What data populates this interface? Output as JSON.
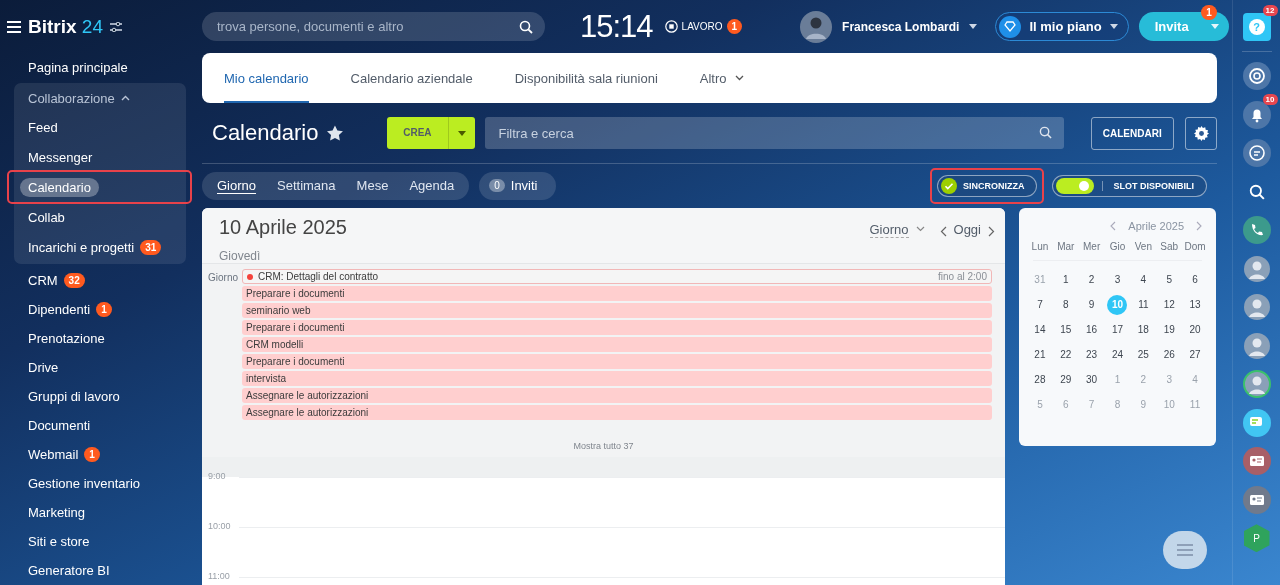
{
  "header": {
    "logo": {
      "name": "Bitrix",
      "number": "24"
    },
    "search": {
      "placeholder": "trova persone, documenti e altro"
    },
    "clock": "15:14",
    "work_status": {
      "label": "LAVORO",
      "badge": "1"
    },
    "user": {
      "name": "Francesca Lombardi"
    },
    "plan": {
      "label": "Il mio piano"
    },
    "invite": {
      "label": "Invita",
      "badge": "1"
    }
  },
  "sidebar": {
    "items": [
      {
        "label": "Pagina principale",
        "kind": "item",
        "selected": false
      },
      {
        "label": "Collaborazione",
        "kind": "group",
        "expanded": true,
        "children": [
          {
            "label": "Feed",
            "selected": false,
            "highlighted": false
          },
          {
            "label": "Messenger",
            "selected": false,
            "highlighted": false
          },
          {
            "label": "Calendario",
            "selected": true,
            "highlighted": true
          },
          {
            "label": "Collab",
            "selected": false,
            "highlighted": false
          },
          {
            "label": "Incarichi e progetti",
            "badge": "31",
            "selected": false,
            "highlighted": false
          }
        ]
      },
      {
        "label": "CRM",
        "badge": "32",
        "kind": "item",
        "selected": false
      },
      {
        "label": "Dipendenti",
        "badge": "1",
        "kind": "item",
        "selected": false
      },
      {
        "label": "Prenotazione",
        "kind": "item",
        "selected": false
      },
      {
        "label": "Drive",
        "kind": "item",
        "selected": false
      },
      {
        "label": "Gruppi di lavoro",
        "kind": "item",
        "selected": false
      },
      {
        "label": "Documenti",
        "kind": "item",
        "selected": false
      },
      {
        "label": "Webmail",
        "badge": "1",
        "kind": "item",
        "selected": false
      },
      {
        "label": "Gestione inventario",
        "kind": "item",
        "selected": false
      },
      {
        "label": "Marketing",
        "kind": "item",
        "selected": false
      },
      {
        "label": "Siti e store",
        "kind": "item",
        "selected": false
      },
      {
        "label": "Generatore BI",
        "kind": "item",
        "selected": false
      }
    ]
  },
  "tabs": [
    {
      "label": "Mio calendario",
      "selected": true,
      "kind": "tab"
    },
    {
      "label": "Calendario aziendale",
      "selected": false,
      "kind": "tab"
    },
    {
      "label": "Disponibilità sala riunioni",
      "selected": false,
      "kind": "tab"
    },
    {
      "label": "Altro",
      "selected": false,
      "kind": "more"
    }
  ],
  "toolbar": {
    "title": "Calendario",
    "create": "CREA",
    "filter": {
      "placeholder": "Filtra e cerca"
    },
    "calendars": "CALENDARI"
  },
  "views": [
    {
      "label": "Giorno",
      "selected": true
    },
    {
      "label": "Settimana",
      "selected": false
    },
    {
      "label": "Mese",
      "selected": false
    },
    {
      "label": "Agenda",
      "selected": false
    }
  ],
  "invites": {
    "count": "0",
    "label": "Inviti"
  },
  "sync": {
    "label": "SINCRONIZZA",
    "checked": true,
    "highlighted": true
  },
  "slots": {
    "label": "SLOT DISPONIBILI",
    "on": true
  },
  "day_view": {
    "date": "10 Aprile 2025",
    "weekday": "Giovedì",
    "view_select": "Giorno",
    "today": "Oggi",
    "allday_label": "Giorno",
    "events": [
      {
        "title": "CRM: Dettagli del contratto",
        "kind": "crm",
        "end": "fino al 2:00"
      },
      {
        "title": "Preparare i documenti",
        "kind": "event"
      },
      {
        "title": "seminario web",
        "kind": "event"
      },
      {
        "title": "Preparare i documenti",
        "kind": "event"
      },
      {
        "title": "CRM modelli",
        "kind": "event"
      },
      {
        "title": "Preparare i documenti",
        "kind": "event"
      },
      {
        "title": "intervista",
        "kind": "event"
      },
      {
        "title": "Assegnare le autorizzazioni",
        "kind": "event"
      },
      {
        "title": "Assegnare le autorizzazioni",
        "kind": "event"
      }
    ],
    "show_all": "Mostra tutto 37",
    "hours": [
      "9:00",
      "10:00",
      "11:00"
    ]
  },
  "mini_calendar": {
    "title": "Aprile 2025",
    "weekdays": [
      "Lun",
      "Mar",
      "Mer",
      "Gio",
      "Ven",
      "Sab",
      "Dom"
    ],
    "weeks": [
      [
        {
          "day": "31",
          "muted": true,
          "selected": false
        },
        {
          "day": "1",
          "muted": false,
          "selected": false
        },
        {
          "day": "2",
          "muted": false,
          "selected": false
        },
        {
          "day": "3",
          "muted": false,
          "selected": false
        },
        {
          "day": "4",
          "muted": false,
          "selected": false
        },
        {
          "day": "5",
          "muted": false,
          "selected": false
        },
        {
          "day": "6",
          "muted": false,
          "selected": false
        }
      ],
      [
        {
          "day": "7",
          "muted": false,
          "selected": false
        },
        {
          "day": "8",
          "muted": false,
          "selected": false
        },
        {
          "day": "9",
          "muted": false,
          "selected": false
        },
        {
          "day": "10",
          "muted": false,
          "selected": true
        },
        {
          "day": "11",
          "muted": false,
          "selected": false
        },
        {
          "day": "12",
          "muted": false,
          "selected": false
        },
        {
          "day": "13",
          "muted": false,
          "selected": false
        }
      ],
      [
        {
          "day": "14",
          "muted": false,
          "selected": false
        },
        {
          "day": "15",
          "muted": false,
          "selected": false
        },
        {
          "day": "16",
          "muted": false,
          "selected": false
        },
        {
          "day": "17",
          "muted": false,
          "selected": false
        },
        {
          "day": "18",
          "muted": false,
          "selected": false
        },
        {
          "day": "19",
          "muted": false,
          "selected": false
        },
        {
          "day": "20",
          "muted": false,
          "selected": false
        }
      ],
      [
        {
          "day": "21",
          "muted": false,
          "selected": false
        },
        {
          "day": "22",
          "muted": false,
          "selected": false
        },
        {
          "day": "23",
          "muted": false,
          "selected": false
        },
        {
          "day": "24",
          "muted": false,
          "selected": false
        },
        {
          "day": "25",
          "muted": false,
          "selected": false
        },
        {
          "day": "26",
          "muted": false,
          "selected": false
        },
        {
          "day": "27",
          "muted": false,
          "selected": false
        }
      ],
      [
        {
          "day": "28",
          "muted": false,
          "selected": false
        },
        {
          "day": "29",
          "muted": false,
          "selected": false
        },
        {
          "day": "30",
          "muted": false,
          "selected": false
        },
        {
          "day": "1",
          "muted": true,
          "selected": false
        },
        {
          "day": "2",
          "muted": true,
          "selected": false
        },
        {
          "day": "3",
          "muted": true,
          "selected": false
        },
        {
          "day": "4",
          "muted": true,
          "selected": false
        }
      ],
      [
        {
          "day": "5",
          "muted": true,
          "selected": false
        },
        {
          "day": "6",
          "muted": true,
          "selected": false
        },
        {
          "day": "7",
          "muted": true,
          "selected": false
        },
        {
          "day": "8",
          "muted": true,
          "selected": false
        },
        {
          "day": "9",
          "muted": true,
          "selected": false
        },
        {
          "day": "10",
          "muted": true,
          "selected": false
        },
        {
          "day": "11",
          "muted": true,
          "selected": false
        }
      ]
    ]
  },
  "right_rail": [
    {
      "kind": "help",
      "badge": "12",
      "text": "?"
    },
    {
      "kind": "copilot"
    },
    {
      "kind": "bell",
      "badge": "10"
    },
    {
      "kind": "chat"
    },
    {
      "kind": "search"
    },
    {
      "kind": "phone"
    },
    {
      "kind": "avatar"
    },
    {
      "kind": "avatar"
    },
    {
      "kind": "avatar"
    },
    {
      "kind": "avatar-ring"
    },
    {
      "kind": "bubble"
    },
    {
      "kind": "card-red"
    },
    {
      "kind": "card-grey"
    },
    {
      "kind": "hexagon",
      "text": "P"
    }
  ]
}
